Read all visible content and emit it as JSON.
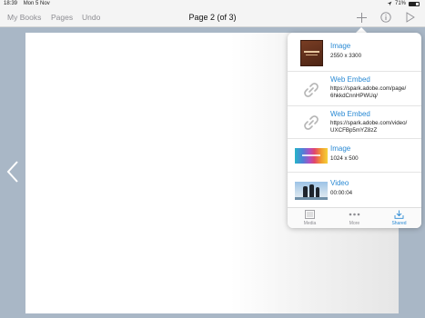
{
  "status_bar": {
    "time": "18:39",
    "date": "Mon 5 Nov",
    "battery_text": "71%",
    "battery_level": 0.71
  },
  "nav": {
    "my_books": "My Books",
    "pages": "Pages",
    "undo": "Undo",
    "title": "Page 2 (of 3)"
  },
  "popover": {
    "items": [
      {
        "type": "Image",
        "detail": "2550 x 3300",
        "thumb": "book-cover"
      },
      {
        "type": "Web Embed",
        "detail_line1": "https://spark.adobe.com/page/",
        "detail_line2": "6hkkdCnnHPWUq/",
        "thumb": "link-icon"
      },
      {
        "type": "Web Embed",
        "detail_line1": "https://spark.adobe.com/video/",
        "detail_line2": "UXCFBp5mYZ8zZ",
        "thumb": "link-icon"
      },
      {
        "type": "Image",
        "detail": "1024 x 500",
        "thumb": "colorful-banner"
      },
      {
        "type": "Video",
        "detail": "00:00:04",
        "thumb": "penguins"
      }
    ],
    "tabs": [
      {
        "label": "Media",
        "icon": "media-list-icon",
        "active": false
      },
      {
        "label": "More",
        "icon": "more-dots-icon",
        "active": false
      },
      {
        "label": "Shared",
        "icon": "shared-download-icon",
        "active": true
      }
    ]
  },
  "colors": {
    "accent": "#2a8ad4",
    "background": "#a9b7c6"
  }
}
